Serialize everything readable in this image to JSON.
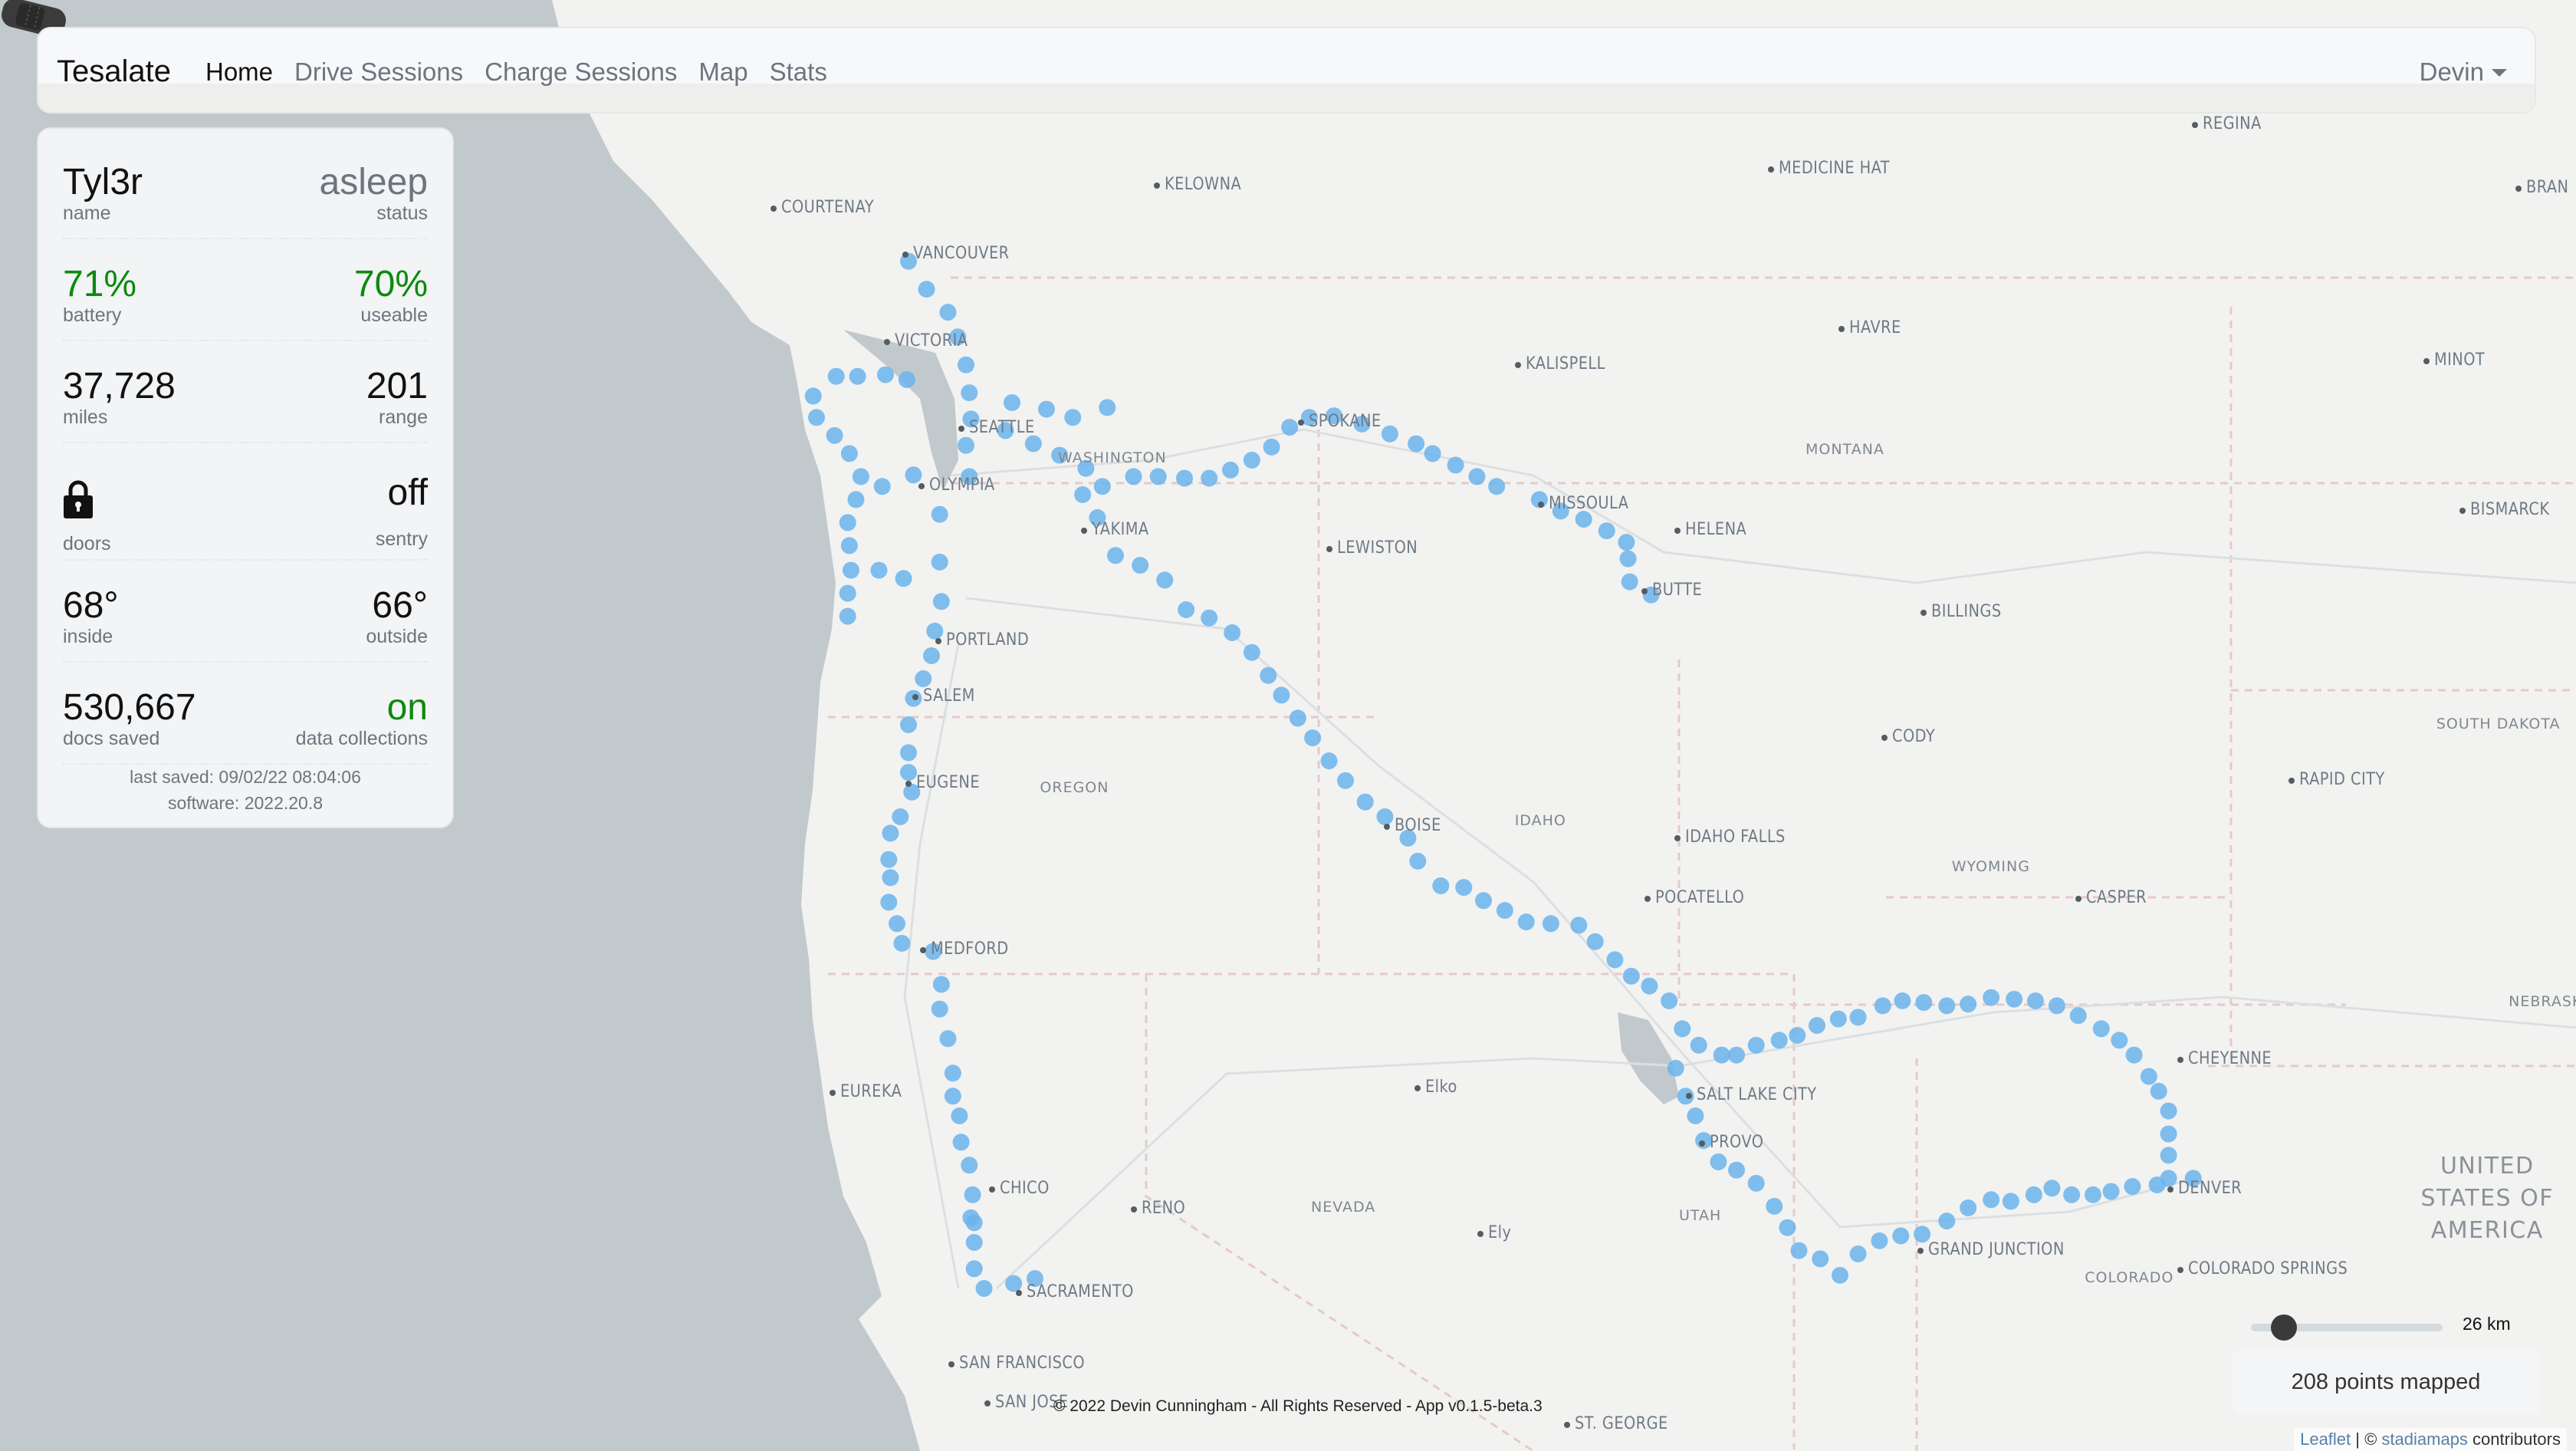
{
  "navbar": {
    "brand": "Tesalate",
    "items": [
      {
        "label": "Home",
        "active": true
      },
      {
        "label": "Drive Sessions",
        "active": false
      },
      {
        "label": "Charge Sessions",
        "active": false
      },
      {
        "label": "Map",
        "active": false
      },
      {
        "label": "Stats",
        "active": false
      }
    ],
    "user": "Devin"
  },
  "vehicle": {
    "name": {
      "value": "Tyl3r",
      "label": "name"
    },
    "status": {
      "value": "asleep",
      "label": "status"
    },
    "battery": {
      "value": "71%",
      "label": "battery"
    },
    "useable": {
      "value": "70%",
      "label": "useable"
    },
    "miles": {
      "value": "37,728",
      "label": "miles"
    },
    "range": {
      "value": "201",
      "label": "range"
    },
    "doors": {
      "icon": "lock-icon",
      "state": "locked",
      "label": "doors"
    },
    "sentry": {
      "value": "off",
      "label": "sentry"
    },
    "inside": {
      "value": "68°",
      "label": "inside"
    },
    "outside": {
      "value": "66°",
      "label": "outside"
    },
    "docs_saved": {
      "value": "530,667",
      "label": "docs saved"
    },
    "data_collections": {
      "value": "on",
      "label": "data collections"
    },
    "last_saved": "last saved: 09/02/22 08:04:06",
    "software": "software: 2022.20.8"
  },
  "map": {
    "radius_slider": {
      "value_label": "26 km",
      "fraction": 0.12
    },
    "points_mapped": "208 points mapped",
    "attribution": {
      "leaflet": "Leaflet",
      "separator": " | © ",
      "provider": "stadiamaps",
      "suffix": " contributors"
    },
    "copyright": "© 2022 Devin Cunningham - All Rights Reserved - App v0.1.5-beta.3",
    "route_color": "#6bb4ec",
    "cities": [
      "COURTENAY",
      "VANCOUVER",
      "KELOWNA",
      "VICTORIA",
      "SEATTLE",
      "OLYMPIA",
      "YAKIMA",
      "SPOKANE",
      "LEWISTON",
      "MISSOULA",
      "HELENA",
      "BUTTE",
      "KALISPELL",
      "MEDICINE HAT",
      "REGINA",
      "HAVRE",
      "MINOT",
      "BRAN",
      "BISMARCK",
      "BILLINGS",
      "CODY",
      "RAPID CITY",
      "PORTLAND",
      "SALEM",
      "EUGENE",
      "MEDFORD",
      "EUREKA",
      "CHICO",
      "RENO",
      "SACRAMENTO",
      "SAN FRANCISCO",
      "SAN JOSE",
      "BOISE",
      "IDAHO FALLS",
      "POCATELLO",
      "CASPER",
      "Elko",
      "Ely",
      "SALT LAKE CITY",
      "PROVO",
      "GRAND JUNCTION",
      "CHEYENNE",
      "DENVER",
      "COLORADO SPRINGS",
      "ST. GEORGE"
    ],
    "regions": [
      "WASHINGTON",
      "OREGON",
      "IDAHO",
      "MONTANA",
      "WYOMING",
      "NEVADA",
      "UTAH",
      "COLORADO",
      "SOUTH DAKOTA",
      "NEBRASKA"
    ],
    "country": "UNITED STATES OF AMERICA"
  }
}
